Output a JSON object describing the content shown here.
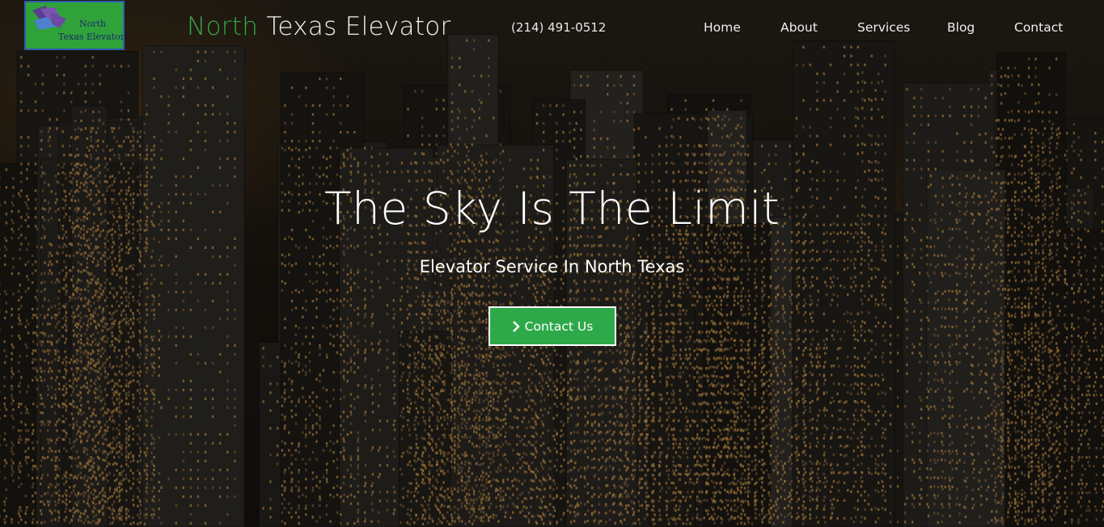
{
  "header": {
    "logo": {
      "line1": "North",
      "line2": "Texas Elevator"
    },
    "brand": {
      "part1": "North",
      "part2": "Texas Elevator"
    },
    "phone": "(214) 491-0512",
    "nav": {
      "home": "Home",
      "about": "About",
      "services": "Services",
      "blog": "Blog",
      "contact": "Contact"
    }
  },
  "hero": {
    "title": "The Sky Is The Limit",
    "subtitle": "Elevator Service In North Texas",
    "cta_label": "Contact Us",
    "cta_icon": "chevron-right-icon",
    "background": "night-city-aerial"
  },
  "colors": {
    "brand_green": "#35a347",
    "cta_green": "#2ea94a",
    "logo_background": "#2fa33a",
    "logo_border": "#2a5fb0"
  }
}
